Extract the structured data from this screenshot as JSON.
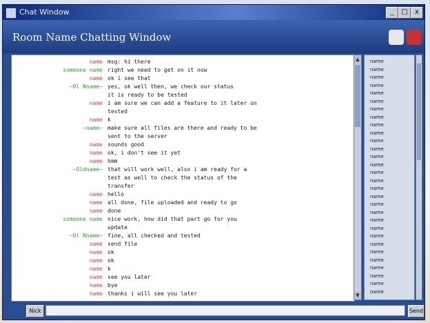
{
  "window": {
    "title": "Chat Window",
    "minimize": "_",
    "maximize": "□",
    "close": "x"
  },
  "header": {
    "title": "Room Name Chatting Window"
  },
  "messages": [
    {
      "nick": "name",
      "text": "msg: hi there"
    },
    {
      "nick": "someone name",
      "text": "right we need to get on it now"
    },
    {
      "nick": "name",
      "text": "ok i see that"
    },
    {
      "nick": "~Ol Nname~",
      "text": "yes, ok well then, we check our status"
    },
    {
      "nick": "",
      "text": "it is ready to be tested"
    },
    {
      "nick": "name",
      "text": "i am sure we can add a feature to it later on"
    },
    {
      "nick": "",
      "text": "tested"
    },
    {
      "nick": "name",
      "text": "k"
    },
    {
      "nick": "~name~",
      "text": "make sure all files are there and ready to be"
    },
    {
      "nick": "",
      "text": "sent to the server"
    },
    {
      "nick": "name",
      "text": "sounds good"
    },
    {
      "nick": "name",
      "text": "ok, i don't see it yet"
    },
    {
      "nick": "name",
      "text": "hmm"
    },
    {
      "nick": "~Oldname~",
      "text": "that will work well, also i am ready for a"
    },
    {
      "nick": "",
      "text": "test as well to check the status of the"
    },
    {
      "nick": "",
      "text": "transfer"
    },
    {
      "nick": "name",
      "text": "hello"
    },
    {
      "nick": "name",
      "text": "all done, file uploaded and ready to go"
    },
    {
      "nick": "name",
      "text": "done"
    },
    {
      "nick": "someone name",
      "text": "nice work, how did that part go for you"
    },
    {
      "nick": "",
      "text": "update"
    },
    {
      "nick": "~Ol Nname~",
      "text": "fine, all checked and tested"
    },
    {
      "nick": "name",
      "text": "send file"
    },
    {
      "nick": "name",
      "text": "ok"
    },
    {
      "nick": "name",
      "text": "ok"
    },
    {
      "nick": "name",
      "text": "k"
    },
    {
      "nick": "name",
      "text": "see you later"
    },
    {
      "nick": "name",
      "text": "bye"
    },
    {
      "nick": "name",
      "text": "thanks i will see you later"
    }
  ],
  "users": [
    "name",
    "name",
    "name",
    "name",
    "name",
    "name",
    "name",
    "name",
    "name",
    "name",
    "name",
    "name",
    "name",
    "name",
    "name",
    "name",
    "name",
    "name",
    "name",
    "name",
    "name",
    "name",
    "name",
    "name",
    "name",
    "name",
    "name",
    "name",
    "name",
    "name"
  ],
  "input": {
    "nick_button": "Nick",
    "placeholder": "",
    "send_button": "Send"
  },
  "colors": {
    "nick_red": "#d43a4a",
    "nick_green": "#2aa52a",
    "nick_orange": "#c07020"
  }
}
